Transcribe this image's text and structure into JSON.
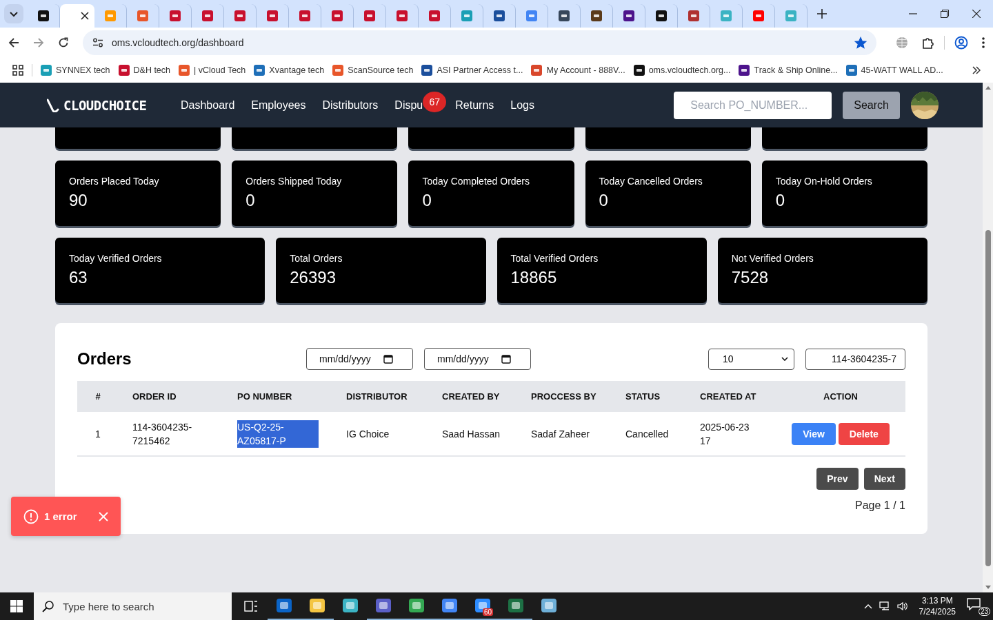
{
  "browser": {
    "tabs": [
      {
        "selected": false,
        "color": "#111111"
      },
      {
        "selected": true
      },
      {
        "selected": false,
        "color": "#ff9900"
      },
      {
        "selected": false,
        "color": "#e8562a"
      },
      {
        "selected": false,
        "color": "#c8102e"
      },
      {
        "selected": false,
        "color": "#c8102e"
      },
      {
        "selected": false,
        "color": "#c8102e"
      },
      {
        "selected": false,
        "color": "#c8102e"
      },
      {
        "selected": false,
        "color": "#c8102e"
      },
      {
        "selected": false,
        "color": "#c8102e"
      },
      {
        "selected": false,
        "color": "#c8102e"
      },
      {
        "selected": false,
        "color": "#c8102e"
      },
      {
        "selected": false,
        "color": "#c8102e"
      },
      {
        "selected": false,
        "color": "#1a9fb5"
      },
      {
        "selected": false,
        "color": "#1b4f9c"
      },
      {
        "selected": false,
        "color": "#4285f4"
      },
      {
        "selected": false,
        "color": "#37475a"
      },
      {
        "selected": false,
        "color": "#5a3a1a"
      },
      {
        "selected": false,
        "color": "#4d148c"
      },
      {
        "selected": false,
        "color": "#111111"
      },
      {
        "selected": false,
        "color": "#b03030"
      },
      {
        "selected": false,
        "color": "#3bb3c3"
      },
      {
        "selected": false,
        "color": "#ff0000"
      },
      {
        "selected": false,
        "color": "#3bb3c3"
      }
    ],
    "url": "oms.vcloudtech.org/dashboard",
    "bookmarked": true,
    "bookmarks": [
      {
        "label": "SYNNEX tech",
        "color": "#1a9fb5"
      },
      {
        "label": "D&H tech",
        "color": "#c8102e"
      },
      {
        "label": "| vCloud Tech",
        "color": "#e8562a"
      },
      {
        "label": "Xvantage tech",
        "color": "#1e6fb8"
      },
      {
        "label": "ScanSource tech",
        "color": "#e8562a"
      },
      {
        "label": "ASI Partner Access t...",
        "color": "#1b4f9c"
      },
      {
        "label": "My Account - 888V...",
        "color": "#d9472b"
      },
      {
        "label": "oms.vcloudtech.org...",
        "color": "#111111"
      },
      {
        "label": "Track & Ship Online...",
        "color": "#4d148c"
      },
      {
        "label": "45-WATT WALL AD...",
        "color": "#1e6fb8"
      }
    ]
  },
  "app": {
    "logo": "CLOUDCHOICE",
    "nav": [
      {
        "label": "Dashboard"
      },
      {
        "label": "Employees"
      },
      {
        "label": "Distributors"
      },
      {
        "label": "Dispu",
        "badge": "67"
      },
      {
        "label": "Returns"
      },
      {
        "label": "Logs"
      }
    ],
    "search": {
      "placeholder": "Search PO_NUMBER...",
      "button": "Search"
    },
    "stat_rows": [
      [
        {
          "label": "Orders Placed Today",
          "value": "90"
        },
        {
          "label": "Orders Shipped Today",
          "value": "0"
        },
        {
          "label": "Today Completed Orders",
          "value": "0"
        },
        {
          "label": "Today Cancelled Orders",
          "value": "0"
        },
        {
          "label": "Today On-Hold Orders",
          "value": "0"
        }
      ],
      [
        {
          "label": "Today Verified Orders",
          "value": "63"
        },
        {
          "label": "Total Orders",
          "value": "26393"
        },
        {
          "label": "Total Verified Orders",
          "value": "18865"
        },
        {
          "label": "Not Verified Orders",
          "value": "7528"
        }
      ]
    ],
    "orders": {
      "title": "Orders",
      "date_from": {
        "placeholder": "mm/dd/yyyy"
      },
      "date_to": {
        "placeholder": "mm/dd/yyyy"
      },
      "page_size": "10",
      "search_value": "114-3604235-7",
      "columns": [
        "#",
        "ORDER ID",
        "PO NUMBER",
        "DISTRIBUTOR",
        "CREATED BY",
        "PROCCESS BY",
        "STATUS",
        "CREATED AT",
        "ACTION"
      ],
      "rows": [
        {
          "cells": [
            {
              "text": "1",
              "highlighted": false
            },
            {
              "text": "114-3604235-7215462",
              "highlighted": false
            },
            {
              "text": "US-Q2-25-AZ05817-P",
              "highlighted": true
            },
            {
              "text": "IG Choice",
              "highlighted": false
            },
            {
              "text": "Saad Hassan",
              "highlighted": false
            },
            {
              "text": "Sadaf Zaheer",
              "highlighted": false
            },
            {
              "text": "Cancelled",
              "highlighted": false
            },
            {
              "text": "2025-06-23 17",
              "highlighted": false
            }
          ],
          "actions": [
            "View",
            "Delete"
          ]
        }
      ],
      "prev": "Prev",
      "next": "Next",
      "page": "Page 1 / 1"
    },
    "toast": {
      "text": "1 error"
    }
  },
  "taskbar": {
    "search_placeholder": "Type here to search",
    "apps": [
      {
        "color": "#0a64c8",
        "running": true
      },
      {
        "color": "#f4c542",
        "running": true
      },
      {
        "color": "#3cb4c4",
        "running": false
      },
      {
        "color": "#5b5fc7",
        "running": true
      },
      {
        "color": "#34a853",
        "running": true
      },
      {
        "color": "#4285f4",
        "running": true
      },
      {
        "color": "#2d8cff",
        "running": true,
        "badge": "60"
      },
      {
        "color": "#1d7044",
        "running": true
      },
      {
        "color": "#6fb0d8",
        "running": false
      }
    ],
    "time": "3:13 PM",
    "date": "7/24/2025",
    "notifications": "23"
  }
}
